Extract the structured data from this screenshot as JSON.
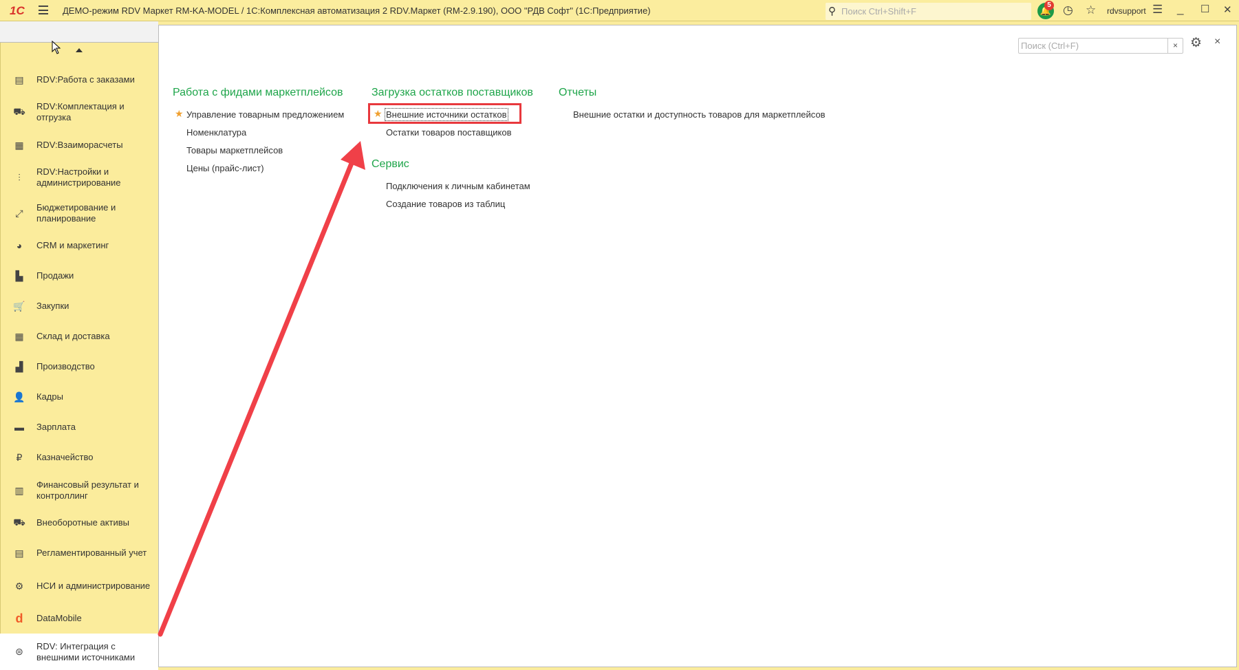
{
  "titlebar": {
    "logo": "1С",
    "title": "ДЕМО-режим RDV Маркет RM-KA-MODEL / 1С:Комплексная автоматизация 2 RDV.Маркет (RM-2.9.190), ООО \"РДВ Софт\"  (1С:Предприятие)",
    "search_placeholder": "Поиск Ctrl+Shift+F",
    "notifications_count": "5",
    "user": "rdvsupport"
  },
  "sidebar": {
    "items": [
      {
        "label": "RDV:Работа с заказами",
        "icon": "clipboard-icon",
        "glyph": "▤"
      },
      {
        "label": "RDV:Комплектация и отгрузка",
        "icon": "cart-box-icon",
        "glyph": "⛟"
      },
      {
        "label": "RDV:Взаиморасчеты",
        "icon": "calculator-icon",
        "glyph": "▦"
      },
      {
        "label": "RDV:Настройки и администрирование",
        "icon": "sliders-icon",
        "glyph": "⫶"
      },
      {
        "label": "Бюджетирование и планирование",
        "icon": "budget-chart-icon",
        "glyph": "⤢"
      },
      {
        "label": "CRM и маркетинг",
        "icon": "pie-chart-icon",
        "glyph": "◕"
      },
      {
        "label": "Продажи",
        "icon": "shopping-bag-icon",
        "glyph": "▙"
      },
      {
        "label": "Закупки",
        "icon": "cart-icon",
        "glyph": "🛒"
      },
      {
        "label": "Склад и доставка",
        "icon": "warehouse-icon",
        "glyph": "▦"
      },
      {
        "label": "Производство",
        "icon": "factory-icon",
        "glyph": "▟"
      },
      {
        "label": "Кадры",
        "icon": "person-icon",
        "glyph": "👤"
      },
      {
        "label": "Зарплата",
        "icon": "card-icon",
        "glyph": "▬"
      },
      {
        "label": "Казначейство",
        "icon": "ruble-icon",
        "glyph": "₽"
      },
      {
        "label": "Финансовый результат и контроллинг",
        "icon": "bar-chart-icon",
        "glyph": "▥"
      },
      {
        "label": "Внеоборотные активы",
        "icon": "truck-icon",
        "glyph": "⛟"
      },
      {
        "label": "Регламентированный учет",
        "icon": "ledger-icon",
        "glyph": "▤"
      },
      {
        "label": "НСИ и администрирование",
        "icon": "gear-icon",
        "glyph": "⚙"
      },
      {
        "label": "DataMobile",
        "icon": "datamobile-icon",
        "glyph": "d"
      },
      {
        "label": "RDV: Интеграция с внешними источниками",
        "icon": "sync-globe-icon",
        "glyph": "⊜"
      }
    ]
  },
  "content": {
    "search_placeholder": "Поиск (Ctrl+F)",
    "sections": [
      {
        "title": "Работа с фидами маркетплейсов",
        "items": [
          "Управление товарным предложением",
          "Номенклатура",
          "Товары маркетплейсов",
          "Цены (прайс-лист)"
        ]
      },
      {
        "title": "Загрузка остатков поставщиков",
        "items": [
          "Внешние источники остатков",
          "Остатки товаров поставщиков"
        ]
      },
      {
        "title": "Сервис",
        "items": [
          "Подключения к личным кабинетам",
          "Создание товаров из таблиц"
        ]
      },
      {
        "title": "Отчеты",
        "items": [
          "Внешние остатки и доступность товаров для маркетплейсов"
        ]
      }
    ]
  },
  "colors": {
    "accent": "#1ea54a",
    "sidebar": "#fbec9c",
    "annotation": "#e8383d"
  }
}
